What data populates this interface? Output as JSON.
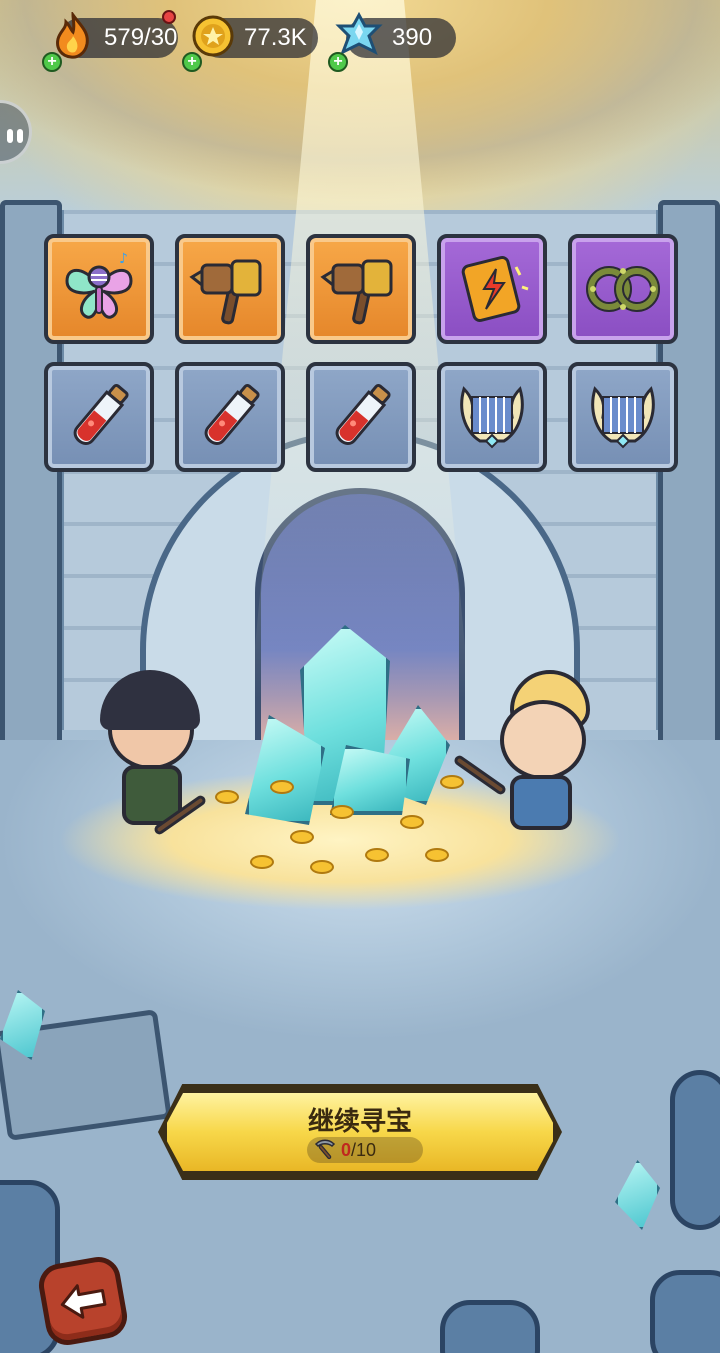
{
  "hud": {
    "energy": {
      "value": "579/30",
      "icon": "flame-icon"
    },
    "gold": {
      "value": "77.3K",
      "icon": "gold-coin-icon"
    },
    "gems": {
      "value": "390",
      "icon": "crystal-icon"
    }
  },
  "loot": [
    {
      "name": "fairy-wings",
      "rarity": "orange",
      "icon": "butterfly-wings-icon"
    },
    {
      "name": "war-hammer",
      "rarity": "orange",
      "icon": "hammer-icon"
    },
    {
      "name": "war-hammer",
      "rarity": "orange",
      "icon": "hammer-icon"
    },
    {
      "name": "spell-book",
      "rarity": "purple",
      "icon": "lightning-book-icon"
    },
    {
      "name": "thorn-ring",
      "rarity": "purple",
      "icon": "thorn-ring-icon"
    },
    {
      "name": "red-potion",
      "rarity": "blue",
      "icon": "potion-icon"
    },
    {
      "name": "red-potion",
      "rarity": "blue",
      "icon": "potion-icon"
    },
    {
      "name": "red-potion",
      "rarity": "blue",
      "icon": "potion-icon"
    },
    {
      "name": "golden-lyre",
      "rarity": "blue",
      "icon": "lyre-icon"
    },
    {
      "name": "golden-lyre",
      "rarity": "blue",
      "icon": "lyre-icon"
    }
  ],
  "action": {
    "label": "继续寻宝",
    "cost_current": "0",
    "cost_total": "/10",
    "cost_icon": "pickaxe-icon"
  },
  "colors": {
    "orange_slot": "#f7a848",
    "purple_slot": "#a56ad8",
    "blue_slot": "#8fa7c8",
    "button_yellow": "#f7d749",
    "back_red": "#b8422c"
  }
}
